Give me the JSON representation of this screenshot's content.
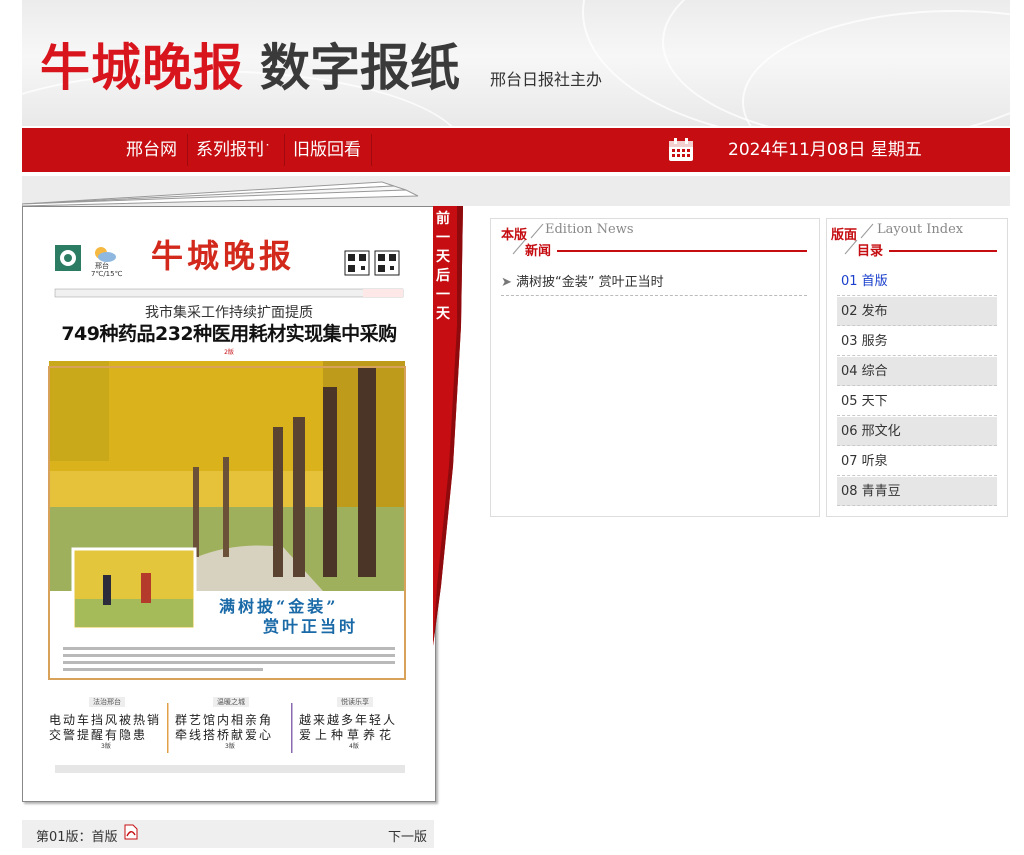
{
  "header": {
    "logo_red": "牛城晚报",
    "logo_dark": "数字报纸",
    "subtitle": "邢台日报社主办"
  },
  "nav": {
    "items": [
      "邢台网",
      "系列报刊",
      "旧版回看"
    ],
    "dropdown_marker": "˙",
    "date": "2024年11月08日 星期五"
  },
  "ribbon": "前一天后一天",
  "paper": {
    "masthead": "牛城晚报",
    "city": "邢台",
    "weather": "7℃/15℃",
    "kicker": "我市集采工作持续扩面提质",
    "headline": "749种药品232种医用耗材实现集中采购",
    "headline_ref": "2版",
    "photo_caption_1": "满树披“金装”",
    "photo_caption_2": "赏叶正当时",
    "teasers": [
      {
        "tag": "法治邢台",
        "line1": "电动车挡风被热销",
        "line2": "交警提醒有隐患",
        "ref": "3版"
      },
      {
        "tag": "温暖之城",
        "line1": "群艺馆内相亲角",
        "line2": "牵线搭桥献爱心",
        "ref": "3版"
      },
      {
        "tag": "悦读乐享",
        "line1": "越来越多年轻人",
        "line2": "爱上种草养花",
        "ref": "4版"
      }
    ]
  },
  "edition_news": {
    "title_cn_1": "本版",
    "title_cn_2": "新闻",
    "title_en": "Edition News",
    "items": [
      "满树披“金装” 赏叶正当时"
    ]
  },
  "layout_index": {
    "title_cn_1": "版面",
    "title_cn_2": "目录",
    "title_en": "Layout Index",
    "items": [
      "01 首版",
      "02 发布",
      "03 服务",
      "04 综合",
      "05 天下",
      "06 邢文化",
      "07 听泉",
      "08 青青豆"
    ]
  },
  "footer": {
    "current": "第01版：首版",
    "next": "下一版"
  },
  "colors": {
    "brand_red": "#c50d12",
    "logo_red": "#d8141c",
    "link_blue": "#1a3fcc"
  }
}
